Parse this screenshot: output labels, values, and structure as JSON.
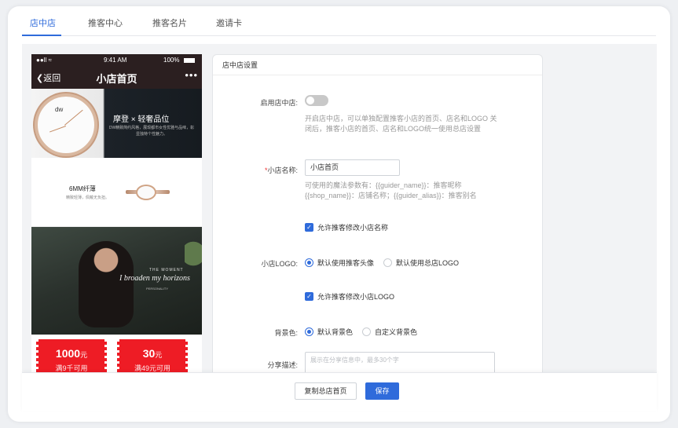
{
  "tabs": [
    {
      "label": "店中店",
      "active": true
    },
    {
      "label": "推客中心",
      "active": false
    },
    {
      "label": "推客名片",
      "active": false
    },
    {
      "label": "邀请卡",
      "active": false
    }
  ],
  "phone": {
    "status_carrier": "●●ll ≈",
    "status_time": "9:41 AM",
    "status_battery": "100%",
    "nav_back": "返回",
    "nav_title": "小店首页",
    "nav_more": "•••",
    "banner1": {
      "brand": "dw",
      "title": "摩登 × 轻奢品位",
      "subtitle": "DW精致简约风格，展现都市女性优雅与品味，彰显独特个性魅力。"
    },
    "banner2": {
      "title": "6MM纤薄",
      "subtitle": "精致轻薄，佩戴无负担。"
    },
    "banner3": {
      "line1": "THE MOMENT",
      "line2": "I broaden my horizons",
      "line3": "PERSONALITY"
    },
    "coupons": [
      {
        "amount": "1000",
        "unit": "元",
        "condition": "满9千可用"
      },
      {
        "amount": "30",
        "unit": "元",
        "condition": "满49元可用"
      }
    ]
  },
  "panel": {
    "title": "店中店设置",
    "enable_label": "启用店中店:",
    "enable_on": false,
    "enable_help_1": "开启店中店，可以单独配置推客小店的首页、店名和LOGO 关",
    "enable_help_2": "闭后，推客小店的首页、店名和LOGO统一使用总店设置",
    "name_required_mark": "*",
    "name_label": "小店名称:",
    "name_value": "小店首页",
    "name_help_1": "可使用的魔法参数有：{{guider_name}}：推客昵称",
    "name_help_2": "{{shop_name}}：店铺名称；{{guider_alias}}：推客别名",
    "allow_name_label": "允许推客修改小店名称",
    "allow_name_checked": true,
    "logo_label": "小店LOGO:",
    "logo_options": [
      "默认使用推客头像",
      "默认使用总店LOGO"
    ],
    "logo_selected": 0,
    "allow_logo_label": "允许推客修改小店LOGO",
    "allow_logo_checked": true,
    "bg_label": "背景色:",
    "bg_options": [
      "默认背景色",
      "自定义背景色"
    ],
    "bg_selected": 0,
    "share_label": "分享描述:",
    "share_placeholder": "展示在分享信息中，最多30个字"
  },
  "footer": {
    "copy_label": "复制总店首页",
    "save_label": "保存"
  },
  "colors": {
    "accent": "#2f6bdb",
    "coupon_red": "#ee1c25",
    "phone_header": "#2b1f20"
  }
}
